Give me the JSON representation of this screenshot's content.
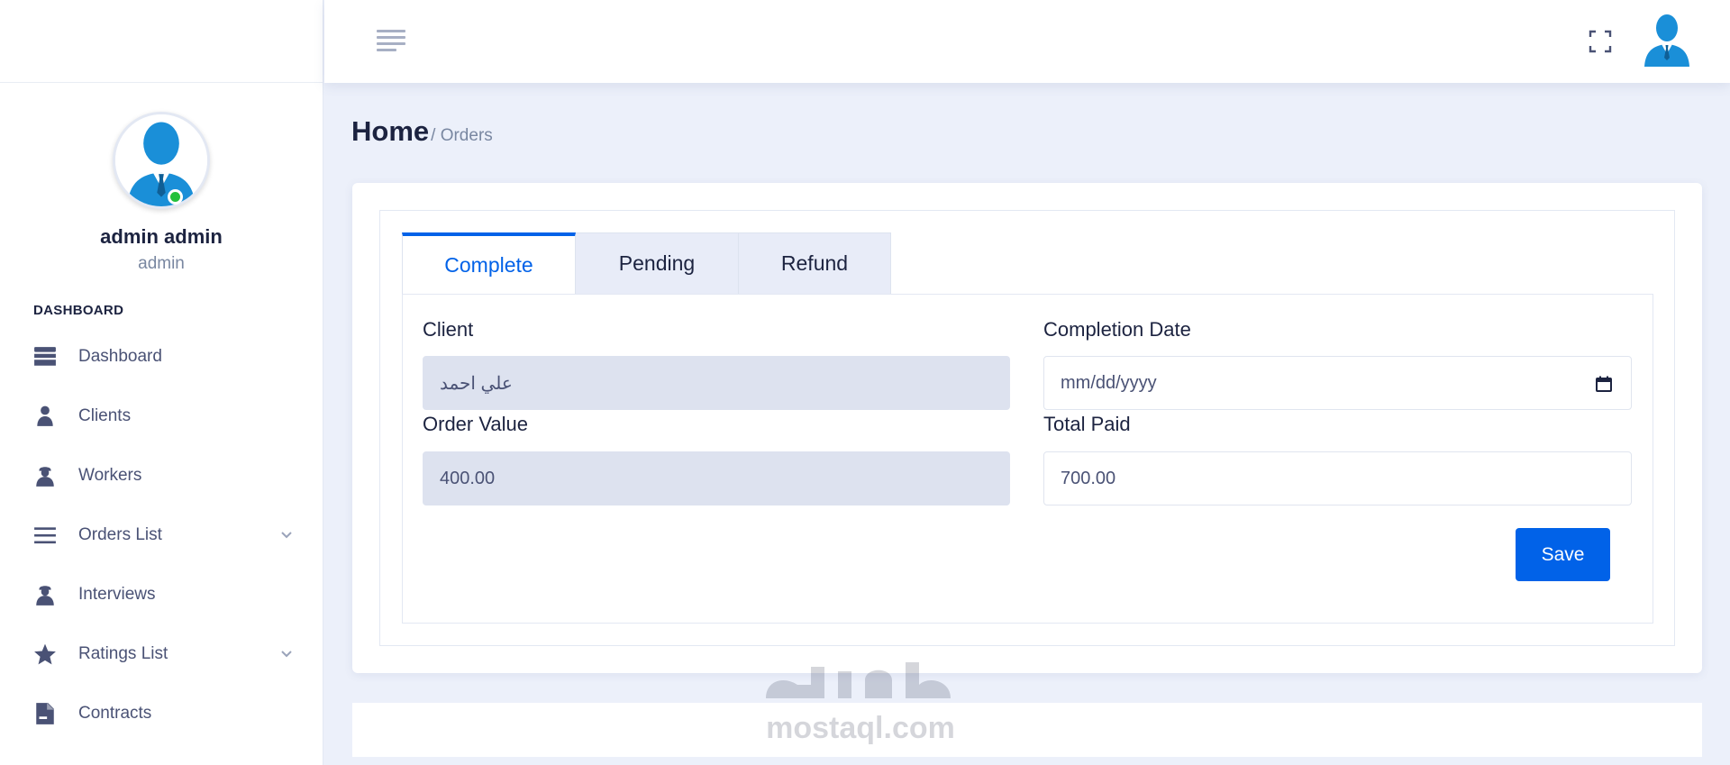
{
  "user": {
    "name": "admin admin",
    "role": "admin"
  },
  "sidebar": {
    "section_label": "DASHBOARD",
    "items": [
      {
        "label": "Dashboard",
        "icon": "dashboard-icon",
        "has_submenu": false
      },
      {
        "label": "Clients",
        "icon": "user-icon",
        "has_submenu": false
      },
      {
        "label": "Workers",
        "icon": "worker-icon",
        "has_submenu": false
      },
      {
        "label": "Orders List",
        "icon": "list-icon",
        "has_submenu": true
      },
      {
        "label": "Interviews",
        "icon": "worker-icon",
        "has_submenu": false
      },
      {
        "label": "Ratings List",
        "icon": "star-icon",
        "has_submenu": true
      },
      {
        "label": "Contracts",
        "icon": "document-icon",
        "has_submenu": false
      }
    ]
  },
  "header": {
    "menu_icon": "hamburger-icon",
    "fullscreen_icon": "fullscreen-icon",
    "avatar_icon": "user-avatar-icon"
  },
  "breadcrumb": {
    "home": "Home",
    "current": "/ Orders"
  },
  "tabs": [
    {
      "label": "Complete",
      "active": true
    },
    {
      "label": "Pending",
      "active": false
    },
    {
      "label": "Refund",
      "active": false
    }
  ],
  "form": {
    "client": {
      "label": "Client",
      "value": "علي احمد",
      "readonly": true
    },
    "completion_date": {
      "label": "Completion Date",
      "placeholder": "mm/dd/yyyy"
    },
    "order_value": {
      "label": "Order Value",
      "value": "400.00",
      "readonly": true
    },
    "total_paid": {
      "label": "Total Paid",
      "value": "700.00"
    },
    "save_label": "Save"
  },
  "watermark": {
    "text": "mostaql.com"
  },
  "colors": {
    "accent": "#0162e8",
    "online": "#22c03c",
    "background": "#ecf0fa",
    "avatar_blue": "#1a8fd8"
  }
}
